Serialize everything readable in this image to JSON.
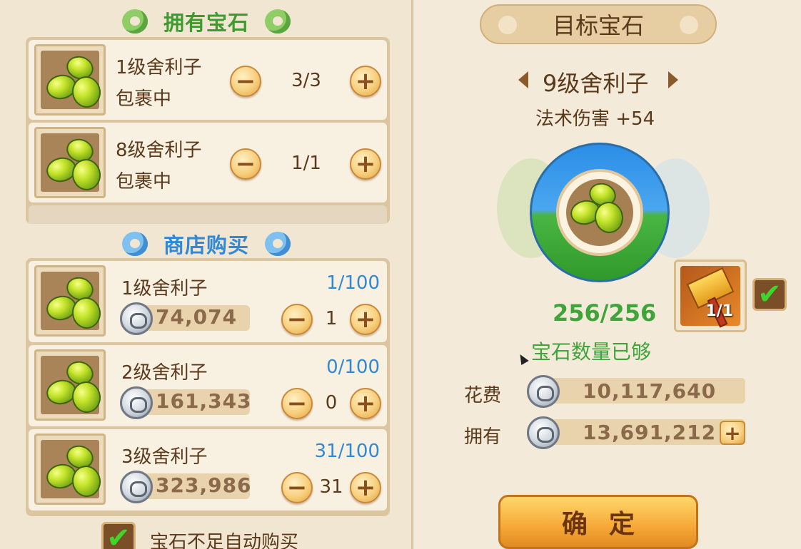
{
  "owned": {
    "title": "拥有宝石",
    "items": [
      {
        "name": "1级舍利子",
        "status": "包裹中",
        "count": "3/3"
      },
      {
        "name": "8级舍利子",
        "status": "包裹中",
        "count": "1/1"
      }
    ]
  },
  "shop": {
    "title": "商店购买",
    "items": [
      {
        "name": "1级舍利子",
        "quota": "1/100",
        "price": "74,074",
        "count": "1"
      },
      {
        "name": "2级舍利子",
        "quota": "0/100",
        "price": "161,343",
        "count": "0"
      },
      {
        "name": "3级舍利子",
        "quota": "31/100",
        "price": "323,986",
        "count": "31"
      }
    ],
    "auto_buy_label": "宝石不足自动购买"
  },
  "target": {
    "title": "目标宝石",
    "gem_name": "9级舍利子",
    "effect": "法术伤害 +54",
    "progress": "256/256",
    "status": "宝石数量已够",
    "hammer_count": "1/1",
    "cost_label": "花费",
    "cost_value": "10,117,640",
    "owned_label": "拥有",
    "owned_value": "13,691,212",
    "confirm_label": "确定"
  },
  "icons": {
    "minus": "−",
    "plus": "+",
    "check": "✔"
  },
  "colors": {
    "green_text": "#3fa43a",
    "blue_text": "#2f89d6",
    "accent_orange": "#f6a837"
  }
}
